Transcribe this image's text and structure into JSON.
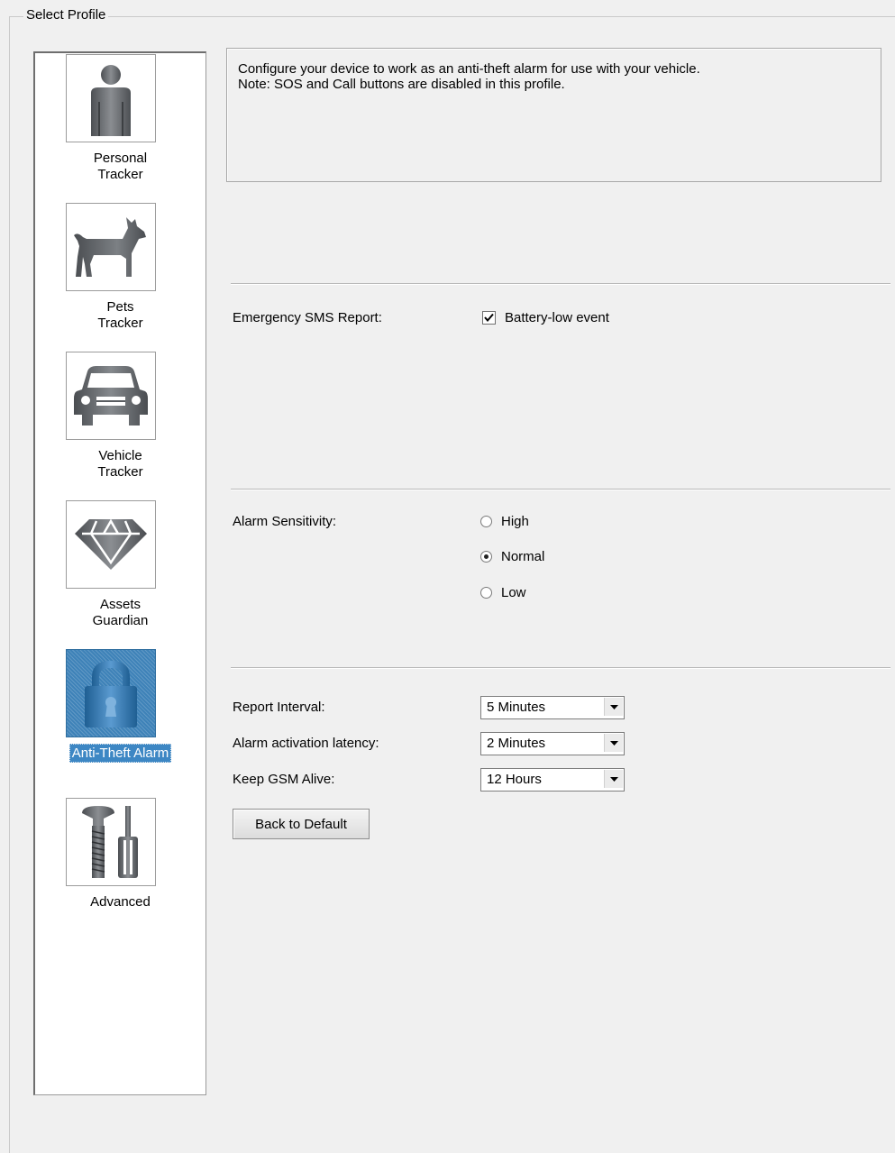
{
  "group_title": "Select Profile",
  "profiles": [
    {
      "label": "Personal\nTracker",
      "icon": "person-icon",
      "selected": false
    },
    {
      "label": "Pets\nTracker",
      "icon": "dog-icon",
      "selected": false
    },
    {
      "label": "Vehicle\nTracker",
      "icon": "car-icon",
      "selected": false
    },
    {
      "label": "Assets\nGuardian",
      "icon": "diamond-icon",
      "selected": false
    },
    {
      "label": "Anti-Theft Alarm",
      "icon": "padlock-icon",
      "selected": true
    },
    {
      "label": "Advanced",
      "icon": "tools-icon",
      "selected": false
    }
  ],
  "description": {
    "line1": "Configure your device to work as an anti-theft alarm for use with your vehicle.",
    "line2": "Note: SOS and Call buttons are disabled in this profile."
  },
  "emergency_sms": {
    "label": "Emergency SMS Report:",
    "checkbox_label": "Battery-low event",
    "checked": true
  },
  "alarm_sensitivity": {
    "label": "Alarm Sensitivity:",
    "options": [
      "High",
      "Normal",
      "Low"
    ],
    "selected": "Normal"
  },
  "settings": {
    "report_interval_label": "Report Interval:",
    "report_interval_value": "5 Minutes",
    "alarm_latency_label": "Alarm activation latency:",
    "alarm_latency_value": "2 Minutes",
    "keep_gsm_label": "Keep GSM Alive:",
    "keep_gsm_value": "12 Hours"
  },
  "back_button": "Back to Default",
  "colors": {
    "background": "#f0f0f0",
    "selection": "#3d87c4",
    "icon_gray": "#5f6266"
  }
}
